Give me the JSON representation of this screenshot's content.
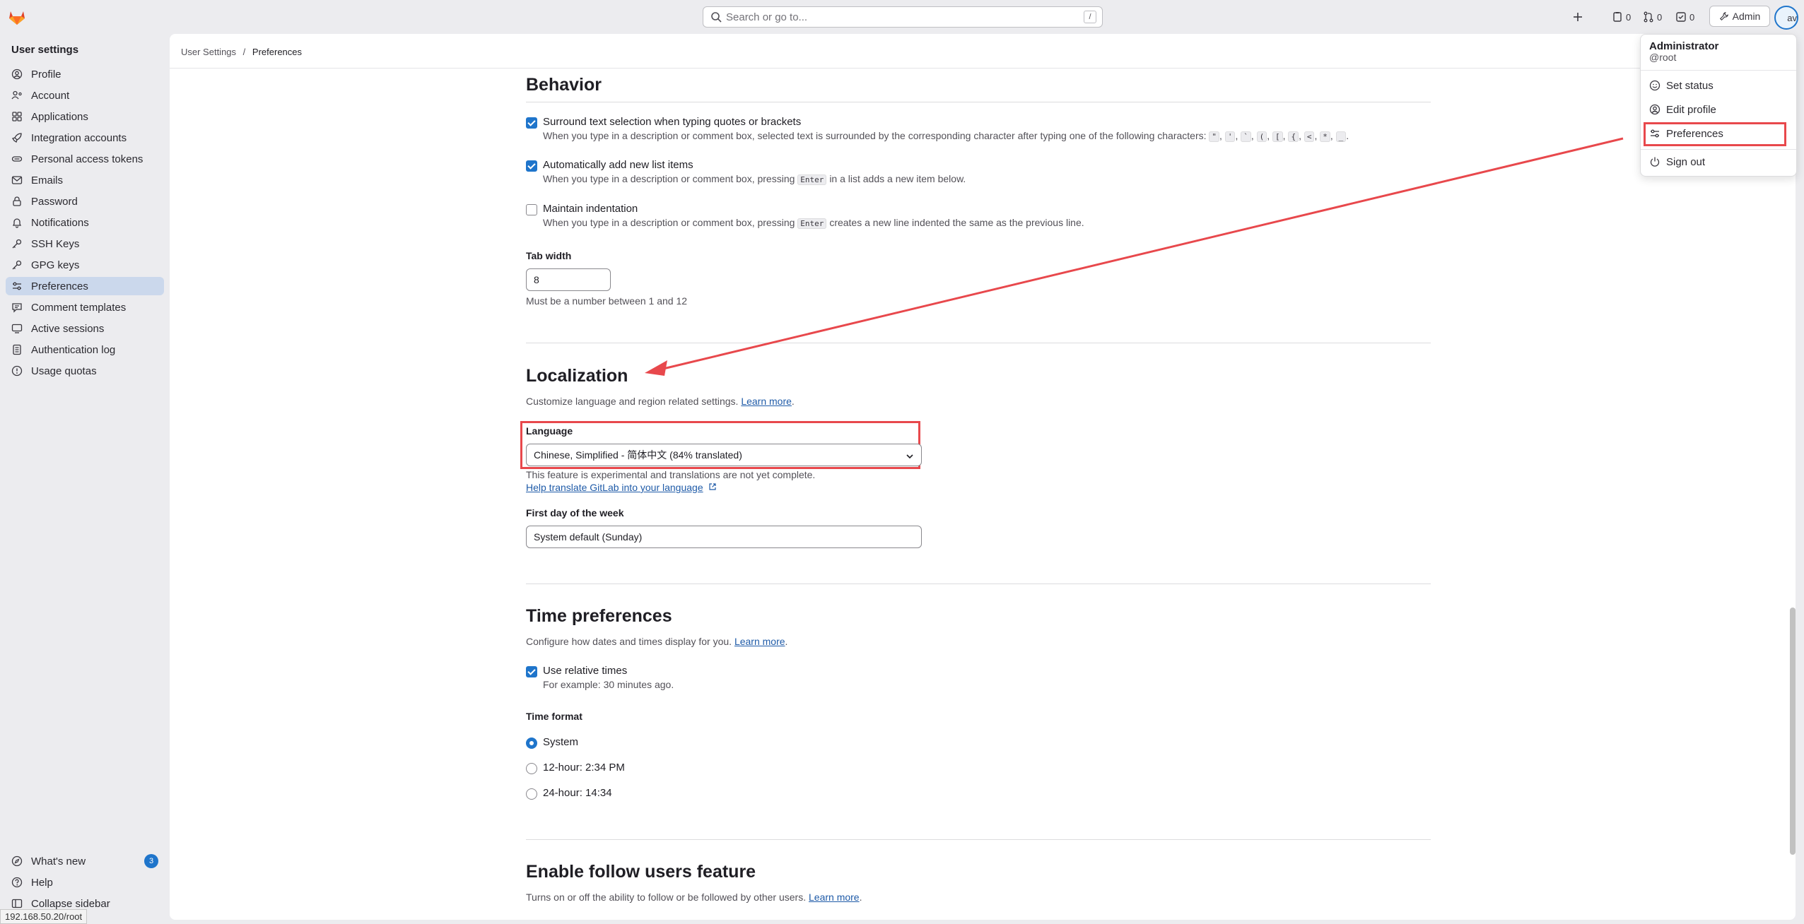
{
  "topbar": {
    "search_placeholder": "Search or go to...",
    "search_shortcut": "/",
    "issues_count": "0",
    "mr_count": "0",
    "todos_count": "0",
    "admin_label": "Admin",
    "avatar_alt": "av"
  },
  "sidebar": {
    "title": "User settings",
    "items": [
      {
        "label": "Profile"
      },
      {
        "label": "Account"
      },
      {
        "label": "Applications"
      },
      {
        "label": "Integration accounts"
      },
      {
        "label": "Personal access tokens"
      },
      {
        "label": "Emails"
      },
      {
        "label": "Password"
      },
      {
        "label": "Notifications"
      },
      {
        "label": "SSH Keys"
      },
      {
        "label": "GPG keys"
      },
      {
        "label": "Preferences"
      },
      {
        "label": "Comment templates"
      },
      {
        "label": "Active sessions"
      },
      {
        "label": "Authentication log"
      },
      {
        "label": "Usage quotas"
      }
    ],
    "whats_new": "What's new",
    "whats_new_count": "3",
    "help": "Help",
    "collapse": "Collapse sidebar",
    "status_url": "192.168.50.20/root"
  },
  "breadcrumb": {
    "parent": "User Settings",
    "sep": "/",
    "current": "Preferences"
  },
  "behavior": {
    "title": "Behavior",
    "surround_title": "Surround text selection when typing quotes or brackets",
    "surround_help": "When you type in a description or comment box, selected text is surrounded by the corresponding character after typing one of the following characters:",
    "surround_chars": [
      "\"",
      "'",
      "`",
      "(",
      "[",
      "{",
      "<",
      "*",
      "_"
    ],
    "autolist_title": "Automatically add new list items",
    "autolist_help_a": "When you type in a description or comment box, pressing",
    "autolist_key": "Enter",
    "autolist_help_b": "in a list adds a new item below.",
    "indent_title": "Maintain indentation",
    "indent_help_a": "When you type in a description or comment box, pressing",
    "indent_key": "Enter",
    "indent_help_b": "creates a new line indented the same as the previous line.",
    "tab_width_label": "Tab width",
    "tab_width_value": "8",
    "tab_width_help": "Must be a number between 1 and 12"
  },
  "localization": {
    "title": "Localization",
    "desc": "Customize language and region related settings.",
    "learn_more": "Learn more",
    "language_label": "Language",
    "language_value": "Chinese, Simplified - 简体中文 (84% translated)",
    "experimental_note": "This feature is experimental and translations are not yet complete.",
    "help_translate": "Help translate GitLab into your language",
    "first_day_label": "First day of the week",
    "first_day_value": "System default (Sunday)"
  },
  "time_prefs": {
    "title": "Time preferences",
    "desc": "Configure how dates and times display for you.",
    "learn_more": "Learn more",
    "relative_title": "Use relative times",
    "relative_help": "For example: 30 minutes ago.",
    "format_label": "Time format",
    "formats": [
      "System",
      "12-hour: 2:34 PM",
      "24-hour: 14:34"
    ],
    "selected_format": "System"
  },
  "follow": {
    "title": "Enable follow users feature",
    "desc": "Turns on or off the ability to follow or be followed by other users.",
    "learn_more": "Learn more"
  },
  "user_menu": {
    "name": "Administrator",
    "username": "@root",
    "set_status": "Set status",
    "edit_profile": "Edit profile",
    "preferences": "Preferences",
    "sign_out": "Sign out"
  },
  "colors": {
    "accent": "#1f75cb",
    "highlight": "#e8484c",
    "active_nav": "#cbd8ec"
  }
}
